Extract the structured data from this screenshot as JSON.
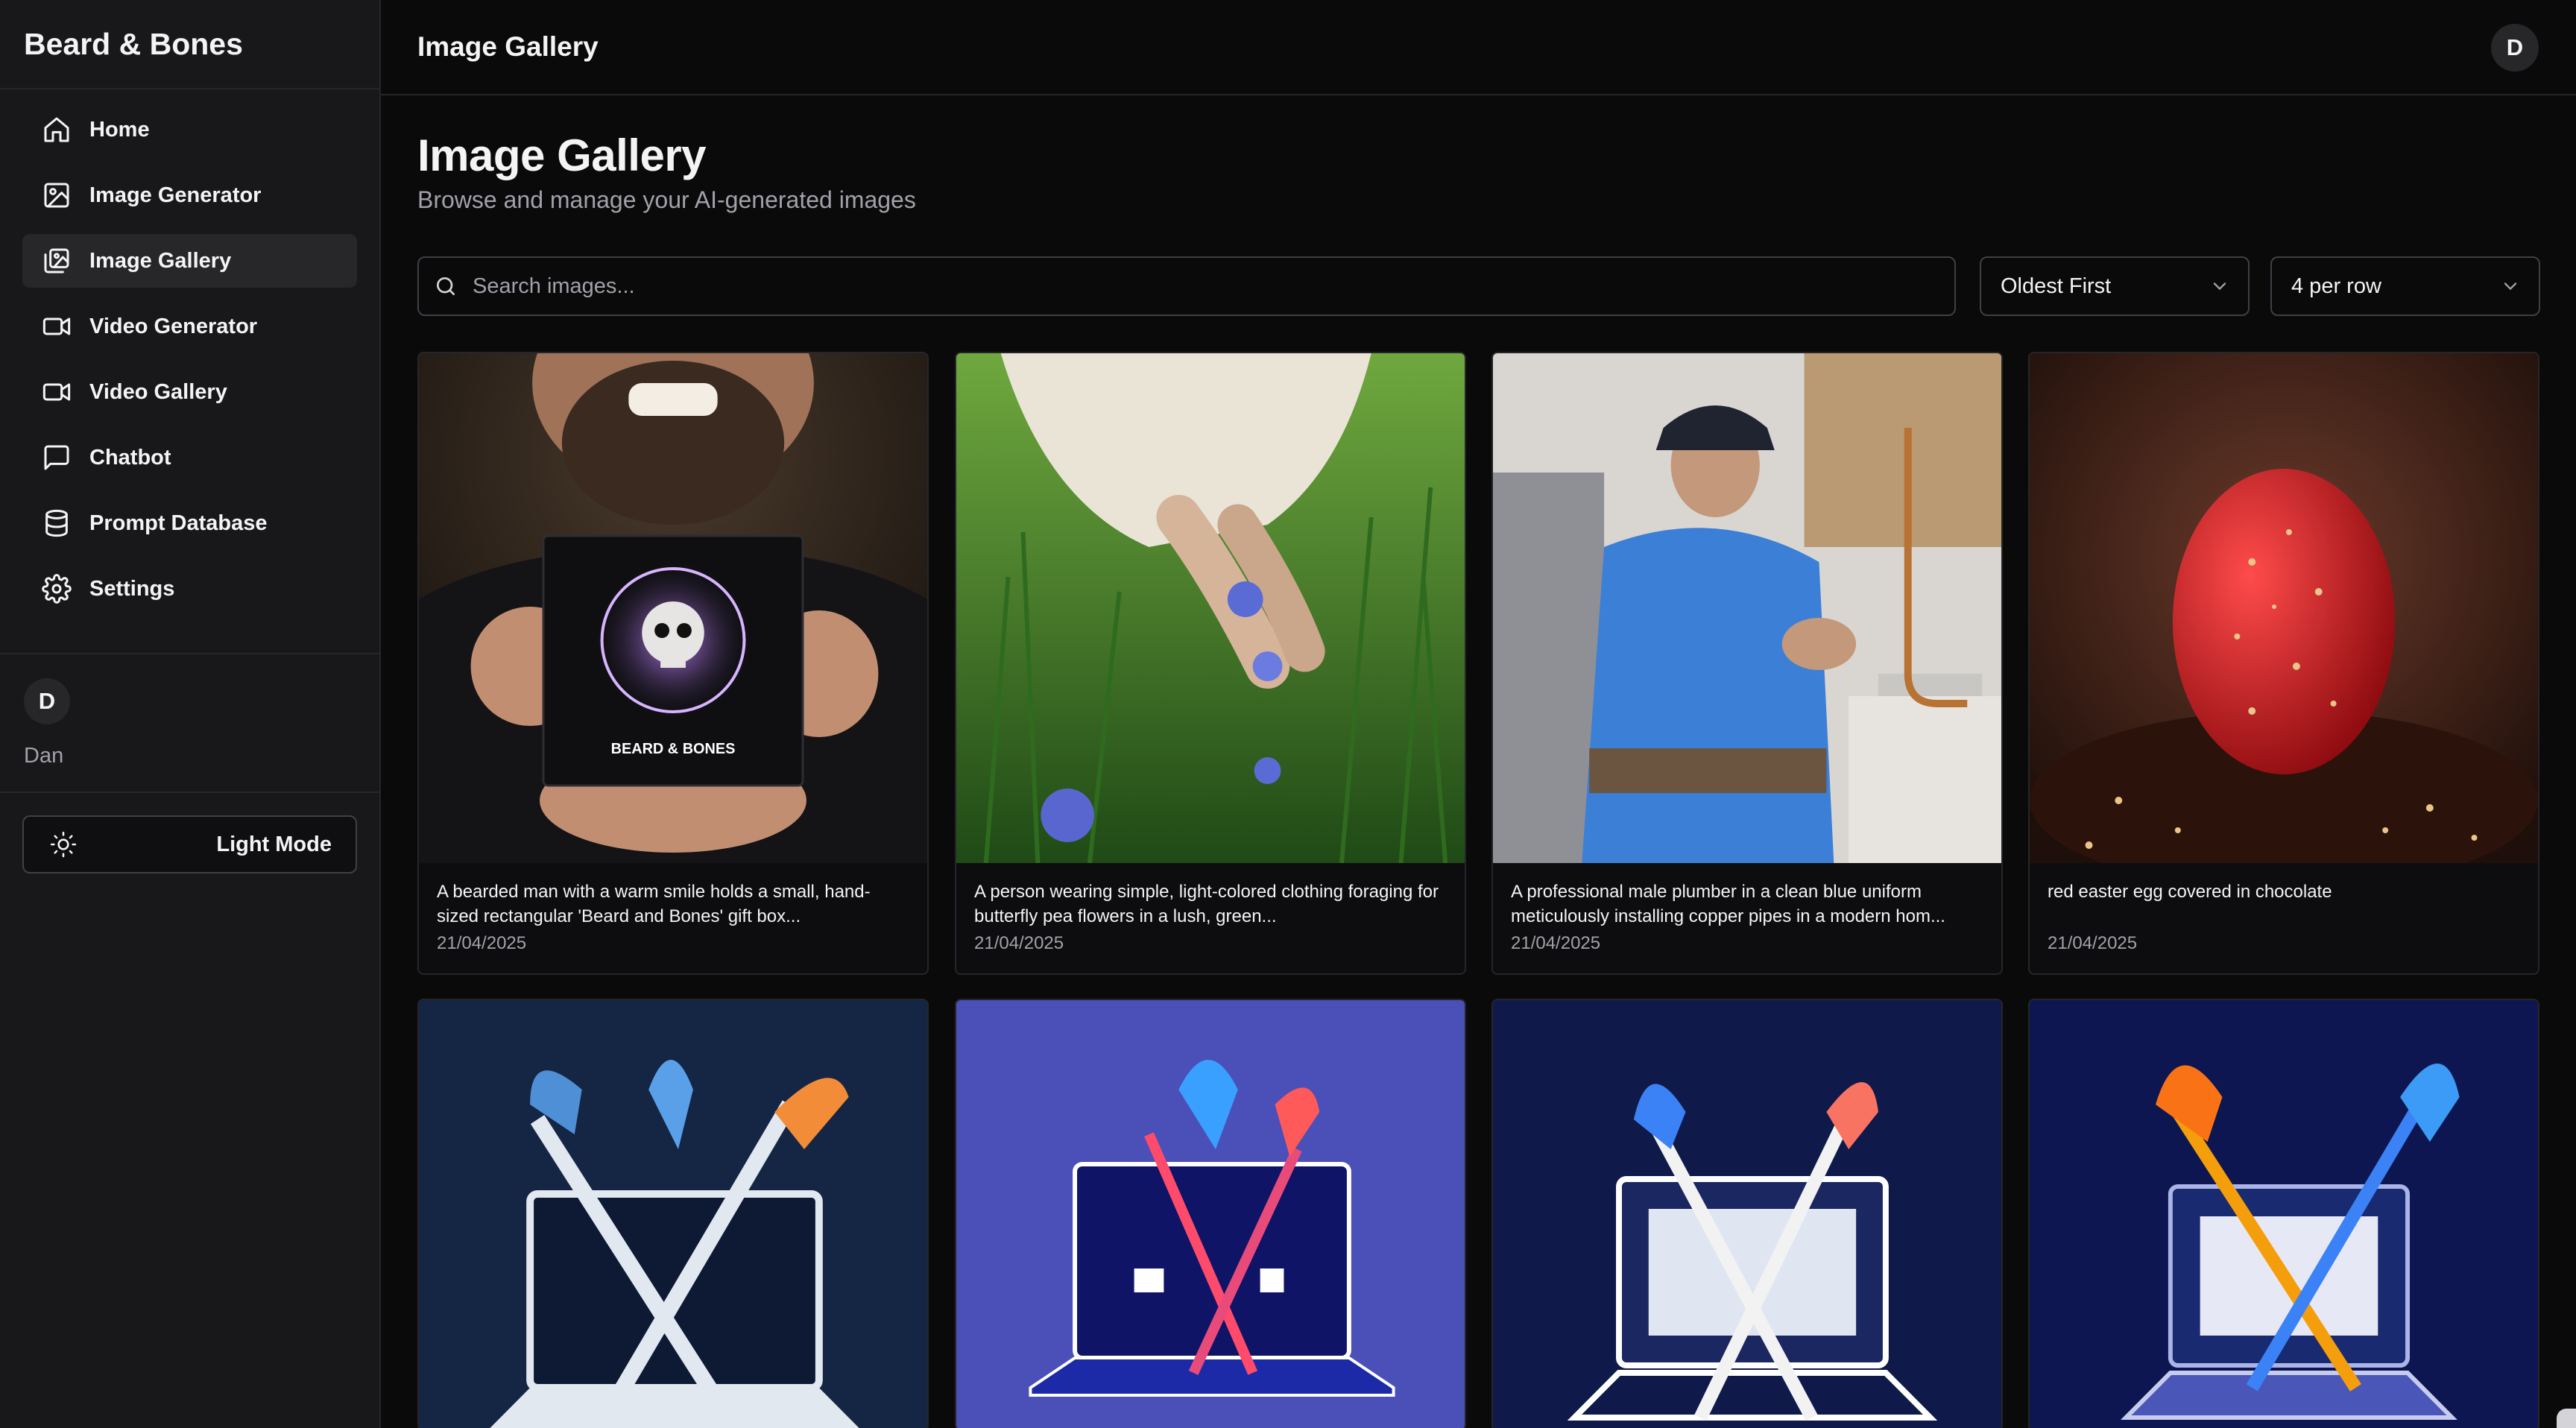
{
  "app": {
    "brand": "Beard & Bones"
  },
  "sidebar": {
    "items": [
      {
        "label": "Home",
        "icon": "home-icon",
        "active": false
      },
      {
        "label": "Image Generator",
        "icon": "image-icon",
        "active": false
      },
      {
        "label": "Image Gallery",
        "icon": "gallery-icon",
        "active": true
      },
      {
        "label": "Video Generator",
        "icon": "video-icon",
        "active": false
      },
      {
        "label": "Video Gallery",
        "icon": "video-icon",
        "active": false
      },
      {
        "label": "Chatbot",
        "icon": "chat-icon",
        "active": false
      },
      {
        "label": "Prompt Database",
        "icon": "database-icon",
        "active": false
      },
      {
        "label": "Settings",
        "icon": "gear-icon",
        "active": false
      }
    ],
    "user": {
      "initial": "D",
      "name": "Dan"
    },
    "mode_toggle": {
      "label": "Light Mode",
      "icon": "sun-icon"
    }
  },
  "topbar": {
    "title": "Image Gallery",
    "avatar_initial": "D"
  },
  "main": {
    "title": "Image Gallery",
    "subtitle": "Browse and manage your AI-generated images",
    "search": {
      "placeholder": "Search images...",
      "value": ""
    },
    "sort": {
      "selected": "Oldest First"
    },
    "per_row": {
      "selected": "4 per row"
    }
  },
  "gallery": [
    {
      "description": "A bearded man with a warm smile holds a small, hand-sized rectangular 'Beard and Bones' gift box...",
      "date": "21/04/2025",
      "box_label": "BEARD & BONES"
    },
    {
      "description": "A person wearing simple, light-colored clothing foraging for butterfly pea flowers in a lush, green...",
      "date": "21/04/2025"
    },
    {
      "description": "A professional male plumber in a clean blue uniform meticulously installing copper pipes in a modern hom...",
      "date": "21/04/2025"
    },
    {
      "description": "red easter egg covered in chocolate",
      "date": "21/04/2025"
    },
    {
      "description": "",
      "date": ""
    },
    {
      "description": "",
      "date": ""
    },
    {
      "description": "",
      "date": ""
    },
    {
      "description": "",
      "date": ""
    }
  ],
  "colors": {
    "background": "#0a0a0b",
    "sidebar": "#18181b",
    "border": "#26262a",
    "active_item": "#27272a",
    "muted_text": "#a1a1aa"
  }
}
